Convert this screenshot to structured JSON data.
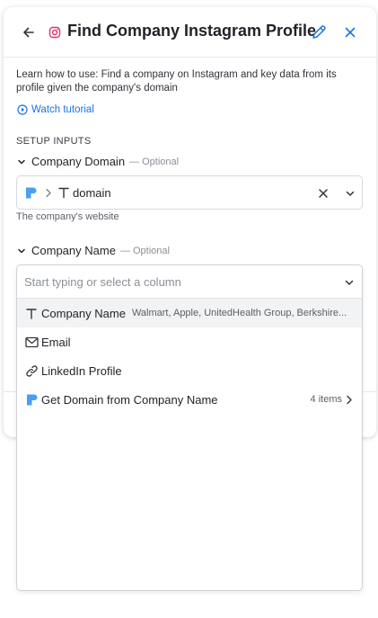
{
  "header": {
    "title": "Find Company Instagram Profile",
    "icons": {
      "back": "arrow-left-icon",
      "brand": "instagram-icon",
      "edit": "pencil-icon",
      "close": "close-icon"
    }
  },
  "intro": {
    "text": "Learn how to use: Find a company on Instagram and key data from its profile given the company's domain",
    "watch_label": "Watch tutorial"
  },
  "setup": {
    "heading": "SETUP INPUTS",
    "company_domain": {
      "label": "Company Domain",
      "optional": "— Optional",
      "value": "domain",
      "help": "The company's website"
    },
    "company_name": {
      "label": "Company Name",
      "optional": "— Optional",
      "placeholder": "Start typing or select a column"
    }
  },
  "dropdown": {
    "options": [
      {
        "label": "Company Name",
        "sub": "Walmart, Apple, UnitedHealth Group, Berkshire...",
        "icon": "text-type-icon"
      },
      {
        "label": "Email",
        "icon": "mail-icon"
      },
      {
        "label": "LinkedIn Profile",
        "icon": "link-icon"
      },
      {
        "label": "Get Domain from Company Name",
        "count": "4 items",
        "icon": "clay-logo-icon"
      }
    ]
  },
  "colors": {
    "accent": "#1a73e8",
    "logo_blue": "#4a9ff5",
    "instagram": "#e1306c"
  }
}
